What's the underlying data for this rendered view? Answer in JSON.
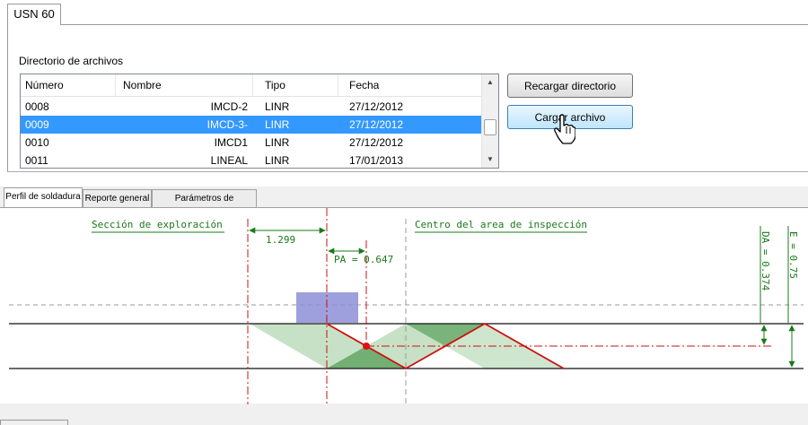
{
  "top_tab": "USN 60",
  "directory": {
    "label": "Directorio de archivos",
    "columns": [
      "Número",
      "Nombre",
      "Tipo",
      "Fecha"
    ],
    "rows": [
      {
        "numero": "0008",
        "nombre": "IMCD-2",
        "tipo": "LINR",
        "fecha": "27/12/2012",
        "selected": false
      },
      {
        "numero": "0009",
        "nombre": "IMCD-3-",
        "tipo": "LINR",
        "fecha": "27/12/2012",
        "selected": true
      },
      {
        "numero": "0010",
        "nombre": "IMCD1",
        "tipo": "LINR",
        "fecha": "27/12/2012",
        "selected": false
      },
      {
        "numero": "0011",
        "nombre": "LINEAL",
        "tipo": "LINR",
        "fecha": "17/01/2013",
        "selected": false
      }
    ]
  },
  "buttons": {
    "reload": "Recargar directorio",
    "load": "Cargar archivo"
  },
  "bottom_tabs": [
    "Perfil de soldadura",
    "Reporte general",
    "Parámetros de calibración"
  ],
  "profile": {
    "section_label": "Sección de exploración",
    "center_label": "Centro del area de inspección",
    "distance": "1.299",
    "pa": "PA = 0.647",
    "da": "DA = 0.374",
    "e": "E = 0.75"
  },
  "colors": {
    "selection": "#3399ff",
    "annotation_green": "#1a7a1a",
    "beam_red": "#cc1111",
    "probe_blue": "#8c8fd6",
    "beam_fill": "#5caa5c"
  }
}
